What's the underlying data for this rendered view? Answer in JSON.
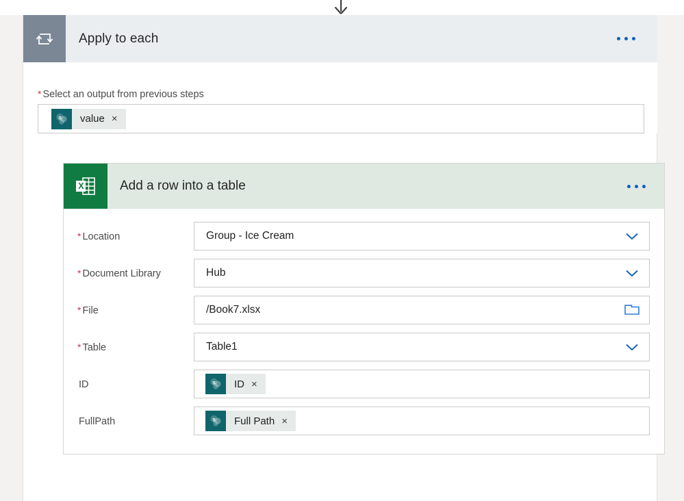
{
  "connector": {
    "icon": "arrow-down-icon"
  },
  "scope": {
    "icon": "loop-repeat-icon",
    "title": "Apply to each",
    "menu_icon": "more-options-icon",
    "input": {
      "required": true,
      "star": "*",
      "label": "Select an output from previous steps",
      "token": {
        "icon": "sharepoint-icon",
        "label": "value",
        "remove_icon": "×"
      }
    }
  },
  "action": {
    "icon": "excel-icon",
    "title": "Add a row into a table",
    "menu_icon": "more-options-icon",
    "parameters": [
      {
        "name": "location",
        "required": true,
        "star": "*",
        "label": "Location",
        "type": "dropdown",
        "value": "Group - Ice Cream",
        "trailing_icon": "chevron-down-icon"
      },
      {
        "name": "document-library",
        "required": true,
        "star": "*",
        "label": "Document Library",
        "type": "dropdown",
        "value": "Hub",
        "trailing_icon": "chevron-down-icon"
      },
      {
        "name": "file",
        "required": true,
        "star": "*",
        "label": "File",
        "type": "filepicker",
        "value": "/Book7.xlsx",
        "trailing_icon": "folder-icon"
      },
      {
        "name": "table",
        "required": true,
        "star": "*",
        "label": "Table",
        "type": "dropdown",
        "value": "Table1",
        "trailing_icon": "chevron-down-icon"
      },
      {
        "name": "id",
        "required": false,
        "star": "",
        "label": "ID",
        "type": "token",
        "token": {
          "icon": "sharepoint-icon",
          "label": "ID",
          "remove_icon": "×"
        }
      },
      {
        "name": "fullpath",
        "required": false,
        "star": "",
        "label": "FullPath",
        "type": "token",
        "token": {
          "icon": "sharepoint-icon",
          "label": "Full Path",
          "remove_icon": "×"
        }
      }
    ]
  },
  "colors": {
    "page_background": "#f3f2f1",
    "scope_header": "#eaeef1",
    "scope_icon_block": "#7b8795",
    "action_header": "#dfe9e2",
    "excel_green": "#107c41",
    "sharepoint_teal": "#10646b",
    "accent_blue": "#1060b5",
    "required_star": "#c8374a",
    "token_chip": "#e6ebe9",
    "field_border": "#c9c9c7"
  }
}
